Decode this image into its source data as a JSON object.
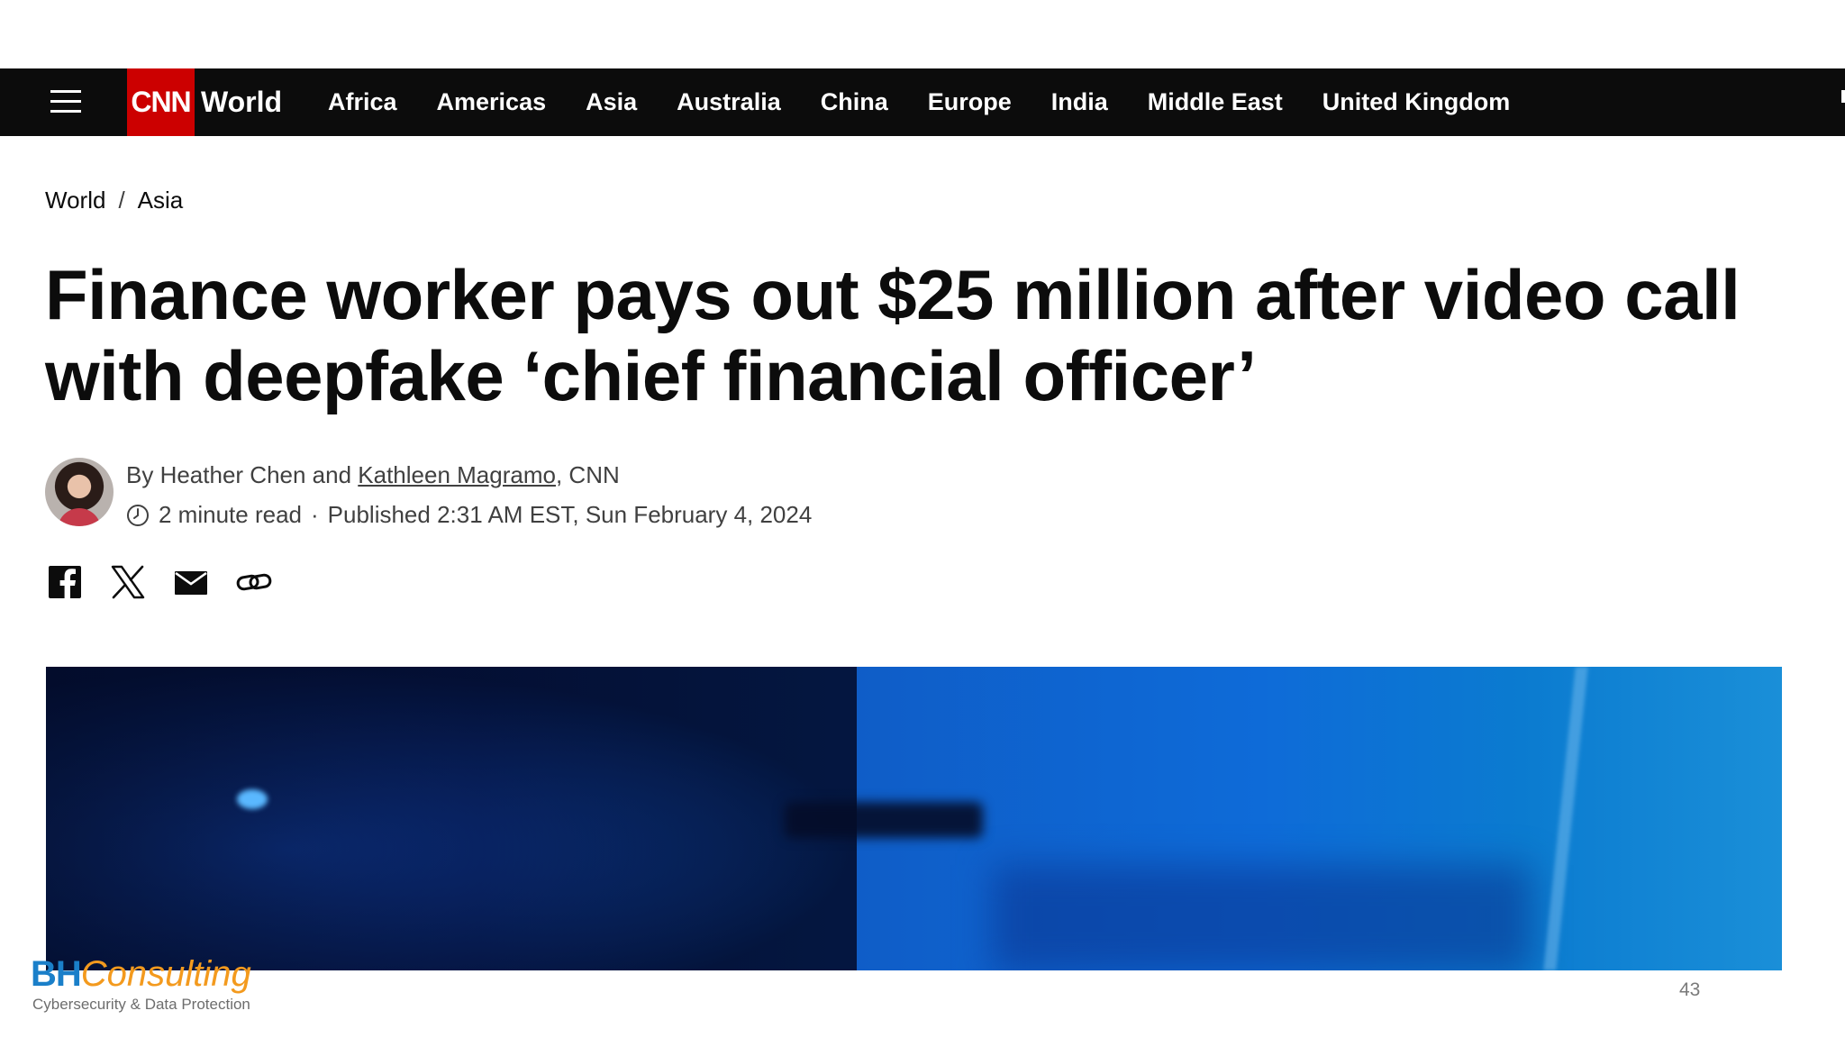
{
  "nav": {
    "logo_text": "CNN",
    "section": "World",
    "links": [
      "Africa",
      "Americas",
      "Asia",
      "Australia",
      "China",
      "Europe",
      "India",
      "Middle East",
      "United Kingdom"
    ]
  },
  "breadcrumb": {
    "items": [
      "World",
      "Asia"
    ],
    "separator": "/"
  },
  "article": {
    "headline": "Finance worker pays out $25 million after video call with deepfake ‘chief financial officer’",
    "byline_prefix": "By Heather Chen and ",
    "byline_author_link": "Kathleen Magramo",
    "byline_suffix": ", CNN",
    "read_time": "2 minute read",
    "meta_separator": "·",
    "published": "Published 2:31 AM EST, Sun February 4, 2024"
  },
  "share_icons": [
    "facebook-icon",
    "x-icon",
    "email-icon",
    "link-icon"
  ],
  "colors": {
    "nav_background": "#0c0c0c",
    "cnn_red": "#cc0000",
    "text": "#0c0c0c",
    "meta_text": "#404040",
    "bh_blue": "#1a7fc9",
    "bh_orange": "#f39a1e"
  },
  "footer": {
    "brand_bh": "BH",
    "brand_consulting": "Consulting",
    "tagline": "Cybersecurity & Data Protection",
    "page_number": "43"
  }
}
